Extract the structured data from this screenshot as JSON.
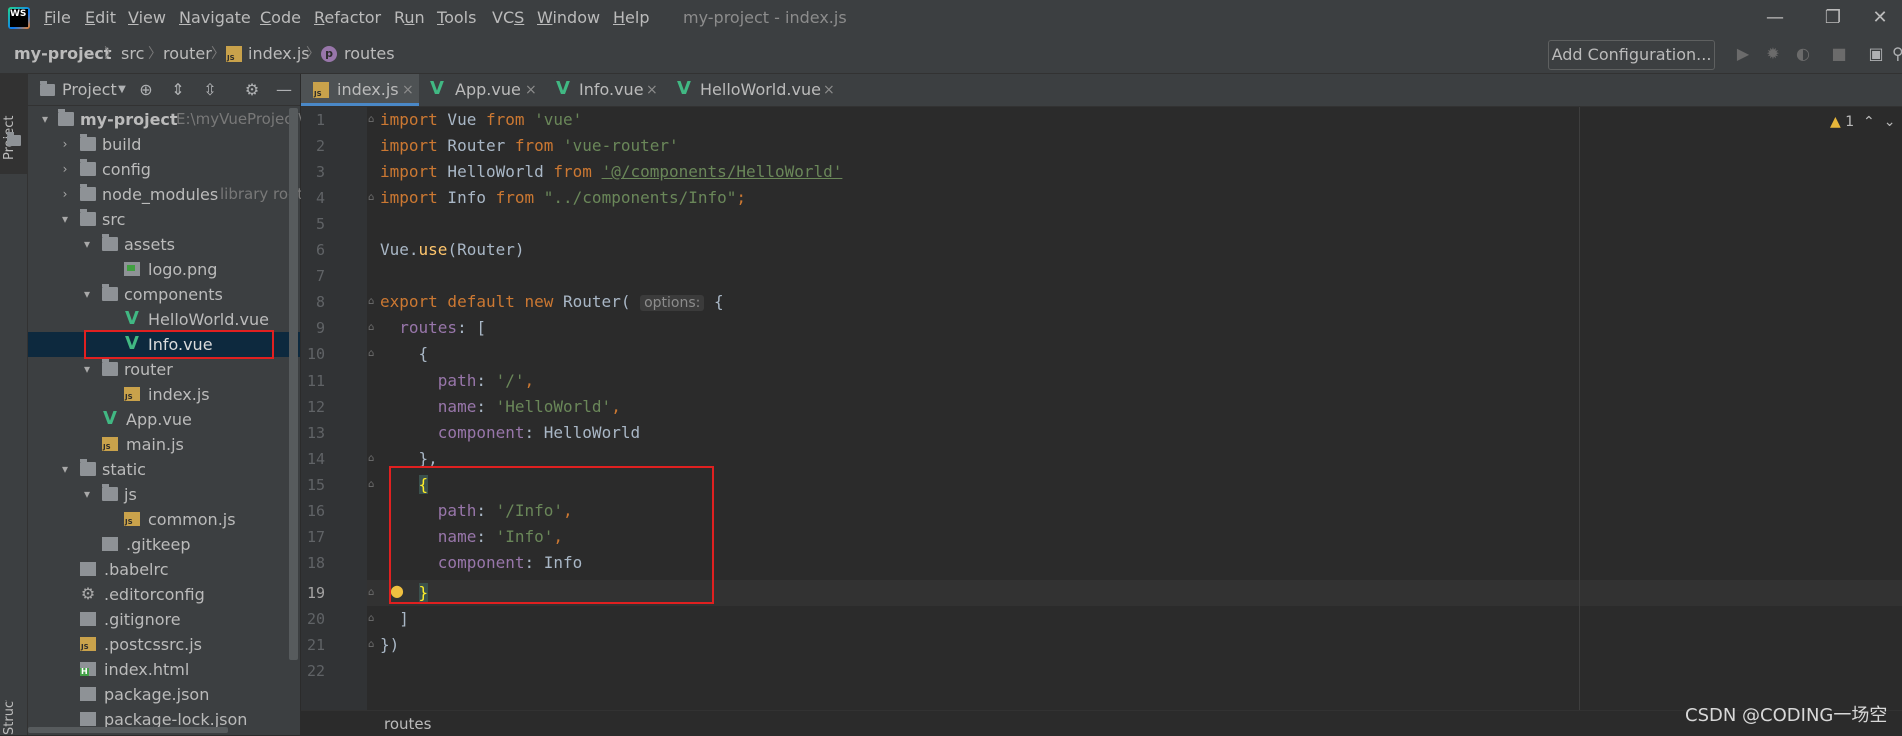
{
  "menubar": {
    "items": [
      {
        "pre": "",
        "u": "F",
        "post": "ile"
      },
      {
        "pre": "",
        "u": "E",
        "post": "dit"
      },
      {
        "pre": "",
        "u": "V",
        "post": "iew"
      },
      {
        "pre": "",
        "u": "N",
        "post": "avigate"
      },
      {
        "pre": "",
        "u": "C",
        "post": "ode"
      },
      {
        "pre": "",
        "u": "R",
        "post": "efactor"
      },
      {
        "pre": "R",
        "u": "u",
        "post": "n"
      },
      {
        "pre": "",
        "u": "T",
        "post": "ools"
      },
      {
        "pre": "VC",
        "u": "S",
        "post": ""
      },
      {
        "pre": "",
        "u": "W",
        "post": "indow"
      },
      {
        "pre": "",
        "u": "H",
        "post": "elp"
      }
    ],
    "window_title": "my-project - index.js",
    "logo_text": "WS"
  },
  "navbar": {
    "crumbs": [
      "my-project",
      "src",
      "router",
      "index.js",
      "routes"
    ],
    "separator": "〉",
    "add_configuration": "Add Configuration..."
  },
  "project_panel": {
    "title": "Project",
    "root_name": "my-project",
    "root_path": "E:\\myVueProject\\",
    "nodes": [
      {
        "label": "build",
        "hint": ""
      },
      {
        "label": "config",
        "hint": ""
      },
      {
        "label": "node_modules",
        "hint": "library root"
      },
      {
        "label": "src",
        "hint": ""
      },
      {
        "label": "assets",
        "hint": ""
      },
      {
        "label": "logo.png",
        "hint": ""
      },
      {
        "label": "components",
        "hint": ""
      },
      {
        "label": "HelloWorld.vue",
        "hint": ""
      },
      {
        "label": "Info.vue",
        "hint": ""
      },
      {
        "label": "router",
        "hint": ""
      },
      {
        "label": "index.js",
        "hint": ""
      },
      {
        "label": "App.vue",
        "hint": ""
      },
      {
        "label": "main.js",
        "hint": ""
      },
      {
        "label": "static",
        "hint": ""
      },
      {
        "label": "js",
        "hint": ""
      },
      {
        "label": "common.js",
        "hint": ""
      },
      {
        "label": ".gitkeep",
        "hint": ""
      },
      {
        "label": ".babelrc",
        "hint": ""
      },
      {
        "label": ".editorconfig",
        "hint": ""
      },
      {
        "label": ".gitignore",
        "hint": ""
      },
      {
        "label": ".postcssrc.js",
        "hint": ""
      },
      {
        "label": "index.html",
        "hint": ""
      },
      {
        "label": "package.json",
        "hint": ""
      },
      {
        "label": "package-lock.json",
        "hint": ""
      }
    ]
  },
  "stripe": {
    "project": "Project",
    "structure": "Structure"
  },
  "tabs": [
    {
      "label": "index.js",
      "close": "×"
    },
    {
      "label": "App.vue",
      "close": "×"
    },
    {
      "label": "Info.vue",
      "close": "×"
    },
    {
      "label": "HelloWorld.vue",
      "close": "×"
    }
  ],
  "editor": {
    "line_numbers": [
      "1",
      "2",
      "3",
      "4",
      "5",
      "6",
      "7",
      "8",
      "9",
      "10",
      "11",
      "12",
      "13",
      "14",
      "15",
      "16",
      "17",
      "18",
      "19",
      "20",
      "21",
      "22"
    ],
    "code": {
      "l1": {
        "kw": "import",
        "a": " Vue ",
        "kw2": "from",
        "sp": " ",
        "str": "'vue'"
      },
      "l2": {
        "kw": "import",
        "a": " Router ",
        "kw2": "from",
        "sp": " ",
        "str": "'vue-router'"
      },
      "l3": {
        "kw": "import",
        "a": " HelloWorld ",
        "kw2": "from",
        "sp": " ",
        "str": "'@/components/HelloWorld'"
      },
      "l4": {
        "kw": "import",
        "a": " Info ",
        "kw2": "from",
        "sp": " ",
        "str": "\"../components/Info\"",
        "semi": ";"
      },
      "l6": {
        "a": "Vue.",
        "fn": "use",
        "b": "(Router)"
      },
      "l8": {
        "kw": "export default new",
        "a": " Router(",
        "hint": "options:",
        "b": " {"
      },
      "l9": {
        "prop": "routes",
        "a": ": ["
      },
      "l10": {
        "a": "{"
      },
      "l11": {
        "prop": "path",
        "a": ": ",
        "str": "'/'",
        "b": ","
      },
      "l12": {
        "prop": "name",
        "a": ": ",
        "str": "'HelloWorld'",
        "b": ","
      },
      "l13": {
        "prop": "component",
        "a": ": HelloWorld"
      },
      "l14": {
        "a": "},"
      },
      "l15": {
        "a": "{"
      },
      "l16": {
        "prop": "path",
        "a": ": ",
        "str": "'/Info'",
        "b": ","
      },
      "l17": {
        "prop": "name",
        "a": ": ",
        "str": "'Info'",
        "b": ","
      },
      "l18": {
        "prop": "component",
        "a": ": Info"
      },
      "l19": {
        "a": "}"
      },
      "l20": {
        "a": "]"
      },
      "l21": {
        "a": "})"
      }
    },
    "inspection_count": "1",
    "inspection_icon": "▲"
  },
  "bottom": {
    "crumb": "routes"
  },
  "watermark": "CSDN @CODING一场空",
  "colors": {
    "keyword": "#cc7832",
    "string": "#6a8759",
    "property": "#9876aa",
    "function": "#ffc66d",
    "highlight_box": "#e02020",
    "vue": "#41b883"
  }
}
